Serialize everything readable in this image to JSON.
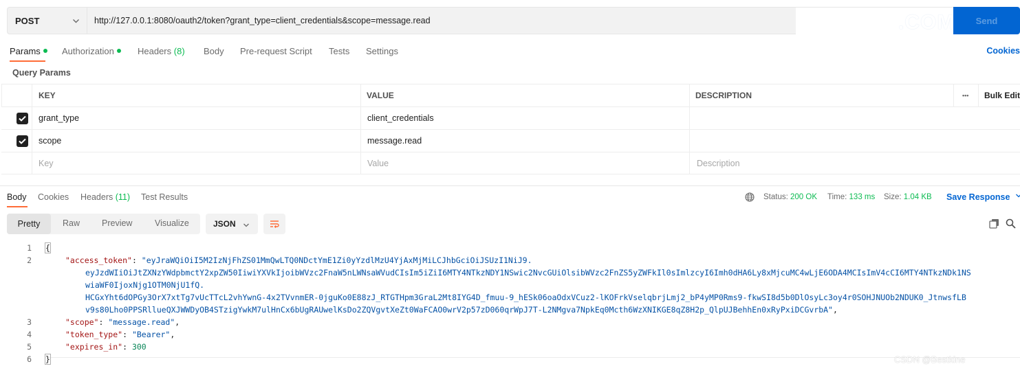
{
  "request": {
    "method": "POST",
    "url": "http://127.0.0.1:8080/oauth2/token?grant_type=client_credentials&scope=message.read",
    "send_label": "Send",
    "watermark": ".COM"
  },
  "request_tabs": [
    {
      "label": "Params",
      "dot": true
    },
    {
      "label": "Authorization",
      "dot": true
    },
    {
      "label": "Headers",
      "count": "(8)"
    },
    {
      "label": "Body"
    },
    {
      "label": "Pre-request Script"
    },
    {
      "label": "Tests"
    },
    {
      "label": "Settings"
    }
  ],
  "cookies_link": "Cookies",
  "query_params": {
    "title": "Query Params",
    "headers": {
      "key": "KEY",
      "value": "VALUE",
      "description": "DESCRIPTION",
      "more": "•••",
      "bulk_edit": "Bulk Edit"
    },
    "rows": [
      {
        "checked": true,
        "key": "grant_type",
        "value": "client_credentials",
        "description": ""
      },
      {
        "checked": true,
        "key": "scope",
        "value": "message.read",
        "description": ""
      }
    ],
    "placeholders": {
      "key": "Key",
      "value": "Value",
      "description": "Description"
    }
  },
  "response": {
    "tabs": [
      {
        "label": "Body"
      },
      {
        "label": "Cookies"
      },
      {
        "label": "Headers",
        "count": "(11)"
      },
      {
        "label": "Test Results"
      }
    ],
    "status_label": "Status:",
    "status_value": "200 OK",
    "time_label": "Time:",
    "time_value": "133 ms",
    "size_label": "Size:",
    "size_value": "1.04 KB",
    "save_response": "Save Response",
    "formats": [
      "Pretty",
      "Raw",
      "Preview",
      "Visualize"
    ],
    "language": "JSON",
    "body": {
      "key_access_token": "\"access_token\"",
      "access_token_1": "\"eyJraWQiOiI5M2IzNjFhZS01MmQwLTQ0NDctYmE1Zi0yYzdlMzU4YjAxMjMiLCJhbGciOiJSUzI1NiJ9.",
      "access_token_2": "eyJzdWIiOiJtZXNzYWdpbmctY2xpZW50IiwiYXVkIjoibWVzc2FnaW5nLWNsaWVudCIsIm5iZiI6MTY4NTkzNDY1NSwic2NvcGUiOlsibWVzc2FnZS5yZWFkIl0sImlzcyI6Imh0dHA6Ly8xMjcuMC4wLjE6ODA4MCIsImV4cCI6MTY4NTkzNDk1NS",
      "access_token_3": "wiaWF0IjoxNjg1OTM0NjU1fQ.",
      "access_token_4": "HCGxYht6dOPGy3OrX7xtTg7vUcTTcL2vhYwnG-4x2TVvnmER-0jguKo0E88zJ_RTGTHpm3GraL2Mt8IYG4D_fmuu-9_hESk06oaOdxVCuz2-lKOFrkVselqbrjLmj2_bP4yMP0Rms9-fkwSI8d5b0DlOsyLc3oy4r0SOHJNUOb2NDUK0_JtnwsfLB",
      "access_token_5": "v9s80Lho0PPSRllueQXJWWDyOB4STzigYwkM7ulHnCx6bUgRAUwelKsDo2ZQVgvtXeZt0WaFCAO0wrV2p57zD060qrWpJ7T-L2NMgva7NpkEq0Mcth6WzXNIKGE8qZ8H2p_QlpUJBehhEn0xRyPxiDCGvrbA\"",
      "key_scope": "\"scope\"",
      "scope_value": "\"message.read\"",
      "key_token_type": "\"token_type\"",
      "token_type_value": "\"Bearer\"",
      "key_expires_in": "\"expires_in\"",
      "expires_in_value": "300"
    },
    "line_numbers": [
      "1",
      "2",
      "3",
      "4",
      "5",
      "6"
    ],
    "bottom_watermark": "CSDN @Bestkine"
  },
  "colors": {
    "accent_orange": "#ff6c37",
    "primary_blue": "#0265d2",
    "success_green": "#0cbb52",
    "json_key": "#a31515",
    "json_string": "#0451a5",
    "json_number": "#098658"
  }
}
